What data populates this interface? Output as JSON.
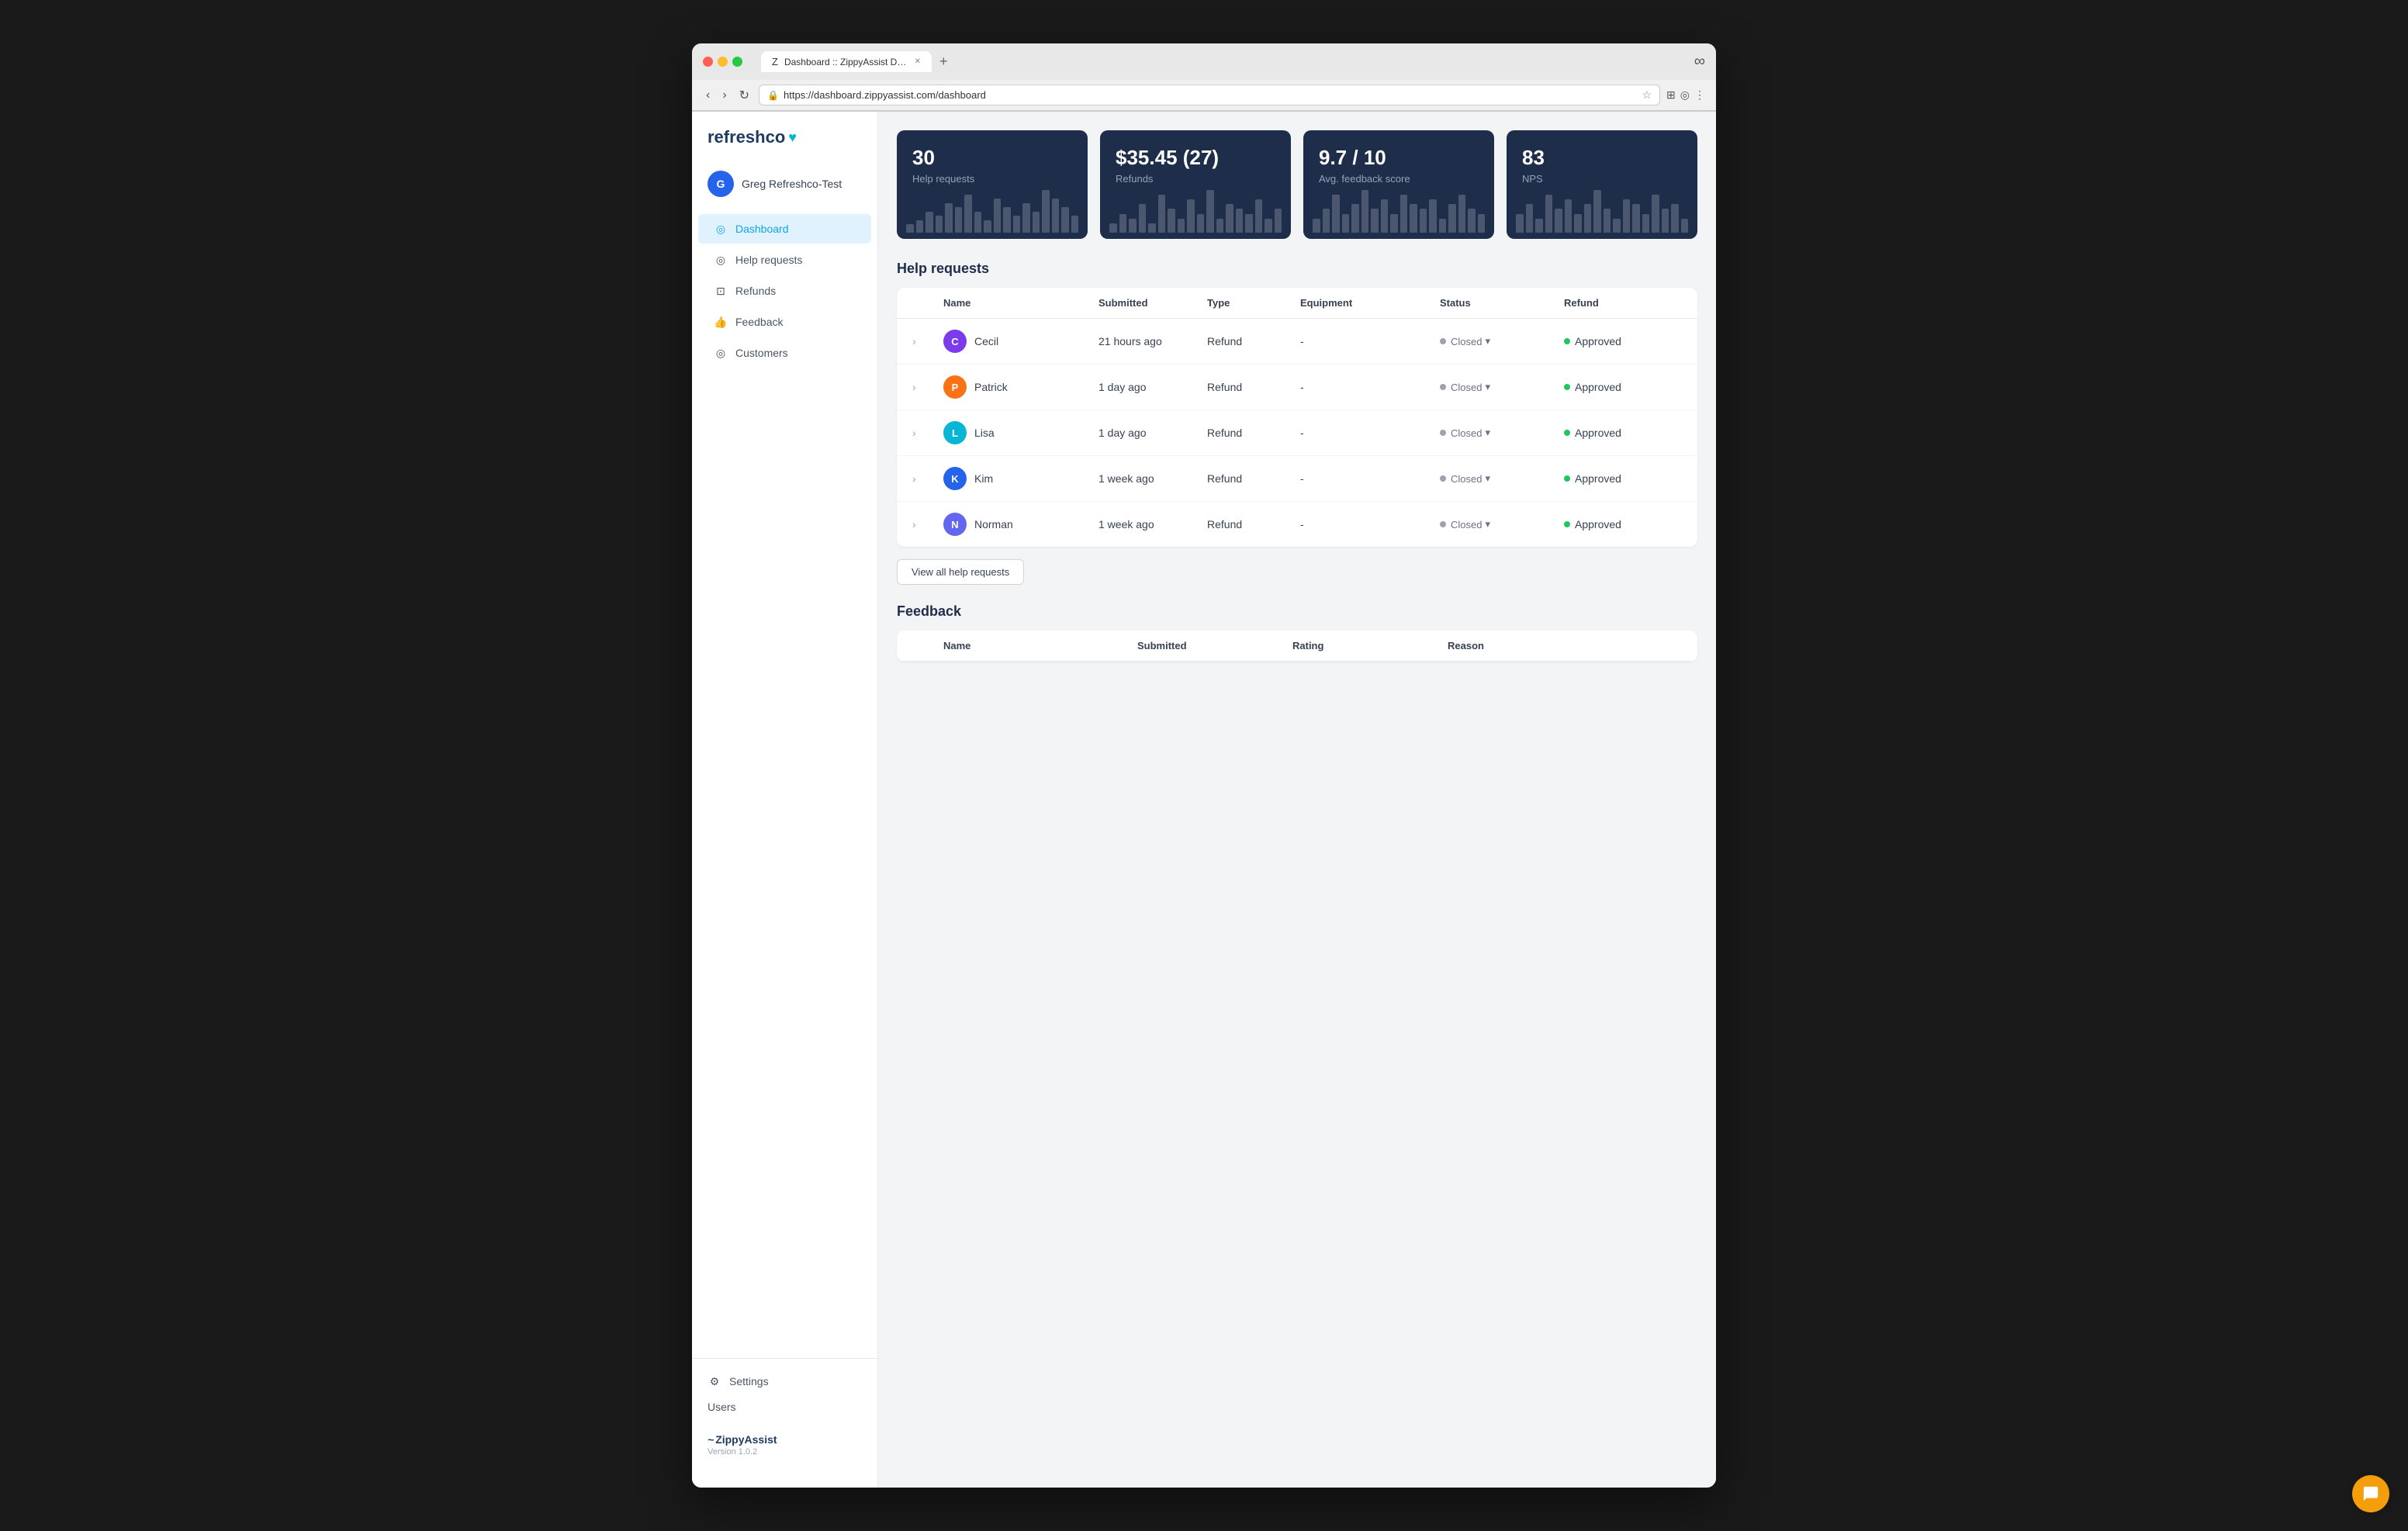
{
  "browser": {
    "tab_title": "Dashboard :: ZippyAssist Dash...",
    "tab_favicon": "Z",
    "url": "https://dashboard.zippyassist.com/dashboard",
    "new_tab_label": "+"
  },
  "sidebar": {
    "logo": "refreshco",
    "logo_suffix": "♥",
    "user": {
      "initial": "G",
      "name": "Greg Refreshco-Test"
    },
    "nav_items": [
      {
        "label": "Dashboard",
        "active": true
      },
      {
        "label": "Help requests",
        "active": false
      },
      {
        "label": "Refunds",
        "active": false
      },
      {
        "label": "Feedback",
        "active": false
      },
      {
        "label": "Customers",
        "active": false
      }
    ],
    "settings_label": "Settings",
    "users_label": "Users",
    "brand_name": "ZippyAssist",
    "version": "Version 1.0.2"
  },
  "stats": [
    {
      "value": "30",
      "label": "Help requests",
      "bars": [
        2,
        3,
        5,
        4,
        7,
        6,
        9,
        5,
        3,
        8,
        6,
        4,
        7,
        5,
        10,
        8,
        6,
        4
      ]
    },
    {
      "value": "$35.45 (27)",
      "label": "Refunds",
      "bars": [
        2,
        4,
        3,
        6,
        2,
        8,
        5,
        3,
        7,
        4,
        9,
        3,
        6,
        5,
        4,
        7,
        3,
        5
      ]
    },
    {
      "value": "9.7 / 10",
      "label": "Avg. feedback score",
      "bars": [
        3,
        5,
        8,
        4,
        6,
        9,
        5,
        7,
        4,
        8,
        6,
        5,
        7,
        3,
        6,
        8,
        5,
        4
      ]
    },
    {
      "value": "83",
      "label": "NPS",
      "bars": [
        4,
        6,
        3,
        8,
        5,
        7,
        4,
        6,
        9,
        5,
        3,
        7,
        6,
        4,
        8,
        5,
        6,
        3
      ]
    }
  ],
  "help_requests": {
    "section_title": "Help requests",
    "columns": [
      "Name",
      "Submitted",
      "Type",
      "Equipment",
      "Status",
      "Refund"
    ],
    "rows": [
      {
        "name": "Cecil",
        "initial": "C",
        "avatar_color": "#7c3aed",
        "submitted": "21 hours ago",
        "type": "Refund",
        "equipment": "-",
        "status": "Closed",
        "refund": "Approved"
      },
      {
        "name": "Patrick",
        "initial": "P",
        "avatar_color": "#f97316",
        "submitted": "1 day ago",
        "type": "Refund",
        "equipment": "-",
        "status": "Closed",
        "refund": "Approved"
      },
      {
        "name": "Lisa",
        "initial": "L",
        "avatar_color": "#06b6d4",
        "submitted": "1 day ago",
        "type": "Refund",
        "equipment": "-",
        "status": "Closed",
        "refund": "Approved"
      },
      {
        "name": "Kim",
        "initial": "K",
        "avatar_color": "#2563eb",
        "submitted": "1 week ago",
        "type": "Refund",
        "equipment": "-",
        "status": "Closed",
        "refund": "Approved"
      },
      {
        "name": "Norman",
        "initial": "N",
        "avatar_color": "#6366f1",
        "submitted": "1 week ago",
        "type": "Refund",
        "equipment": "-",
        "status": "Closed",
        "refund": "Approved"
      }
    ],
    "view_all_label": "View all help requests"
  },
  "feedback": {
    "section_title": "Feedback",
    "columns": [
      "Name",
      "Submitted",
      "Rating",
      "Reason"
    ]
  }
}
